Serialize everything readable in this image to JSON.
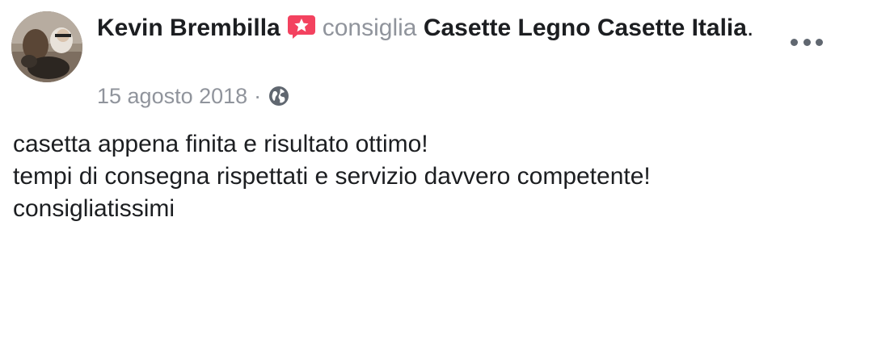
{
  "post": {
    "author": "Kevin Brembilla",
    "verb": "consiglia",
    "page_name": "Casette Legno Casette Italia",
    "period": ".",
    "date": "15 agosto 2018",
    "separator": "·",
    "privacy_icon": "globe-icon",
    "recommend_icon": "recommend-star-icon",
    "more_icon": "more-options-icon",
    "body_lines": [
      "casetta appena finita e risultato ottimo!",
      "tempi di consegna rispettati e servizio davvero competente!",
      "consigliatissimi"
    ]
  },
  "colors": {
    "text": "#1c1e21",
    "muted": "#90949c",
    "badge": "#f3425f"
  }
}
